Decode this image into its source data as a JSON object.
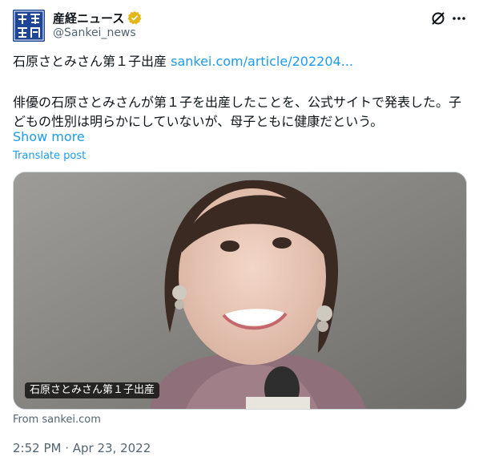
{
  "author": {
    "display_name": "産経ニュース",
    "handle": "@Sankei_news",
    "avatar_text": "産經新聞"
  },
  "post": {
    "headline": "石原さとみさん第１子出産",
    "link": "sankei.com/article/202204...",
    "body": "俳優の石原さとみさんが第１子を出産したことを、公式サイトで発表した。子どもの性別は明らかにしていないが、母子ともに健康だという。",
    "show_more": "Show more",
    "translate": "Translate post"
  },
  "card": {
    "caption": "石原さとみさん第１子出産",
    "source": "From sankei.com"
  },
  "timestamp": "2:52 PM · Apr 23, 2022",
  "colors": {
    "link": "#1d9bf0",
    "muted": "#536471",
    "verified": "#e2b719"
  }
}
